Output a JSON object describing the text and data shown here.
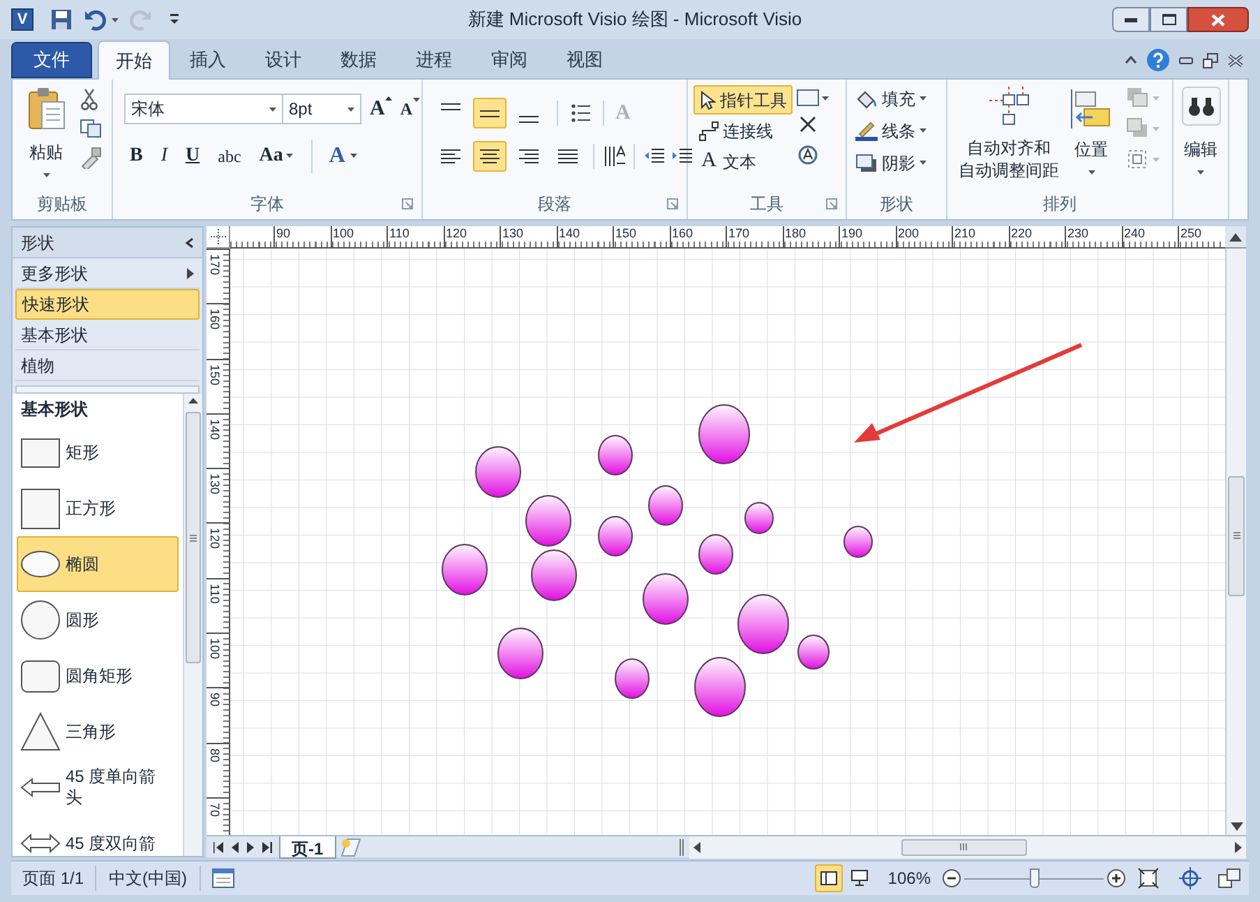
{
  "window": {
    "app_icon": "V",
    "title": "新建 Microsoft Visio 绘图 - Microsoft Visio"
  },
  "tabs": [
    {
      "label": "文件",
      "kind": "file",
      "selected": false
    },
    {
      "label": "开始",
      "kind": "tab",
      "selected": true
    },
    {
      "label": "插入",
      "kind": "tab",
      "selected": false
    },
    {
      "label": "设计",
      "kind": "tab",
      "selected": false
    },
    {
      "label": "数据",
      "kind": "tab",
      "selected": false
    },
    {
      "label": "进程",
      "kind": "tab",
      "selected": false
    },
    {
      "label": "审阅",
      "kind": "tab",
      "selected": false
    },
    {
      "label": "视图",
      "kind": "tab",
      "selected": false
    }
  ],
  "ribbon": {
    "clipboard": {
      "label": "剪贴板",
      "paste": "粘贴"
    },
    "font": {
      "label": "字体",
      "font_name": "宋体",
      "font_size": "8pt",
      "grow": "A",
      "shrink": "A",
      "format_buttons": [
        "B",
        "I",
        "U",
        "abc",
        "Aa"
      ],
      "font_color": "A"
    },
    "paragraph": {
      "label": "段落",
      "text_style": "A",
      "vertical_align": [
        {
          "selected": false
        },
        {
          "selected": true
        },
        {
          "selected": false
        }
      ],
      "horizontal_align": [
        {
          "selected": false
        },
        {
          "selected": true
        },
        {
          "selected": false
        },
        {
          "selected": false
        }
      ]
    },
    "tools": {
      "label": "工具",
      "items": [
        {
          "label": "指针工具",
          "kind": "pointer",
          "selected": true
        },
        {
          "label": "连接线",
          "kind": "connector",
          "selected": false
        },
        {
          "label": "文本",
          "kind": "text",
          "glyph": "A",
          "selected": false
        }
      ]
    },
    "shape": {
      "label": "形状",
      "items": [
        {
          "label": "填充",
          "kind": "fill"
        },
        {
          "label": "线条",
          "kind": "line"
        },
        {
          "label": "阴影",
          "kind": "shadow"
        }
      ]
    },
    "arrange": {
      "label": "排列",
      "auto_align": [
        "自动对齐和",
        "自动调整间距"
      ],
      "position": "位置"
    },
    "edit": {
      "label": "编辑"
    }
  },
  "shapes_panel": {
    "title": "形状",
    "nav": [
      {
        "label": "更多形状",
        "kind": "more",
        "selected": false
      },
      {
        "label": "快速形状",
        "kind": "stencil",
        "selected": true
      },
      {
        "label": "基本形状",
        "kind": "stencil",
        "selected": false
      },
      {
        "label": "植物",
        "kind": "stencil",
        "selected": false
      }
    ],
    "stencil_title": "基本形状",
    "shapes": [
      {
        "label": "矩形",
        "kind": "rect",
        "selected": false
      },
      {
        "label": "正方形",
        "kind": "square",
        "selected": false
      },
      {
        "label": "椭圆",
        "kind": "ellipse",
        "selected": true
      },
      {
        "label": "圆形",
        "kind": "circle",
        "selected": false
      },
      {
        "label": "圆角矩形",
        "kind": "rounded",
        "selected": false
      },
      {
        "label": "三角形",
        "kind": "triangle",
        "selected": false
      },
      {
        "label": "45 度单向箭头",
        "kind": "arrow1",
        "selected": false
      },
      {
        "label": "45 度双向箭",
        "kind": "arrow2",
        "selected": false
      }
    ]
  },
  "rulers": {
    "horizontal": [
      "90",
      "100",
      "110",
      "120",
      "130",
      "140",
      "150",
      "160",
      "170",
      "180",
      "190",
      "200",
      "210",
      "220",
      "230",
      "240",
      "250"
    ],
    "vertical": [
      "170",
      "160",
      "150",
      "140",
      "130",
      "120",
      "110",
      "100",
      "90",
      "80",
      "70"
    ]
  },
  "page_tabs": [
    {
      "label": "页-1",
      "selected": true
    }
  ],
  "status_bar": {
    "page": "页面 1/1",
    "language": "中文(中国)",
    "zoom": "106%",
    "zoom_slider": {
      "level": 0.5
    }
  }
}
